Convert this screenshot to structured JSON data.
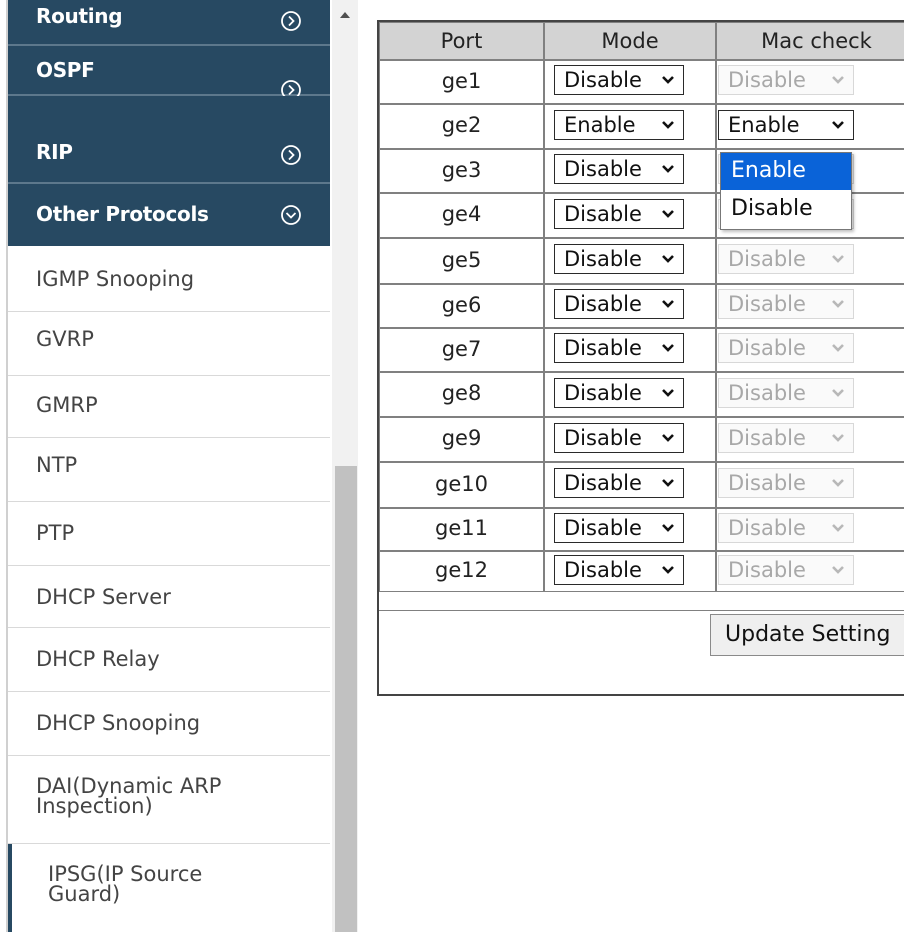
{
  "sidebar": {
    "sections": [
      {
        "label": "Routing",
        "icon": "chevron-right-circle-icon"
      },
      {
        "label": "OSPF",
        "icon": "chevron-right-circle-icon"
      },
      {
        "label": "RIP",
        "icon": "chevron-right-circle-icon"
      },
      {
        "label": "Other Protocols",
        "icon": "chevron-down-circle-icon"
      }
    ],
    "items": [
      {
        "label": "IGMP Snooping"
      },
      {
        "label": "GVRP"
      },
      {
        "label": "GMRP"
      },
      {
        "label": "NTP"
      },
      {
        "label": "PTP"
      },
      {
        "label": "DHCP Server"
      },
      {
        "label": "DHCP Relay"
      },
      {
        "label": "DHCP Snooping"
      },
      {
        "label_line1": "DAI(Dynamic ARP",
        "label_line2": "Inspection)"
      },
      {
        "label_line1": "IPSG(IP Source",
        "label_line2": "Guard)",
        "active": true
      }
    ]
  },
  "table": {
    "headers": {
      "port": "Port",
      "mode": "Mode",
      "mac_check": "Mac check"
    },
    "rows": [
      {
        "port": "ge1",
        "mode": "Disable",
        "mac_check": "Disable"
      },
      {
        "port": "ge2",
        "mode": "Enable",
        "mac_check": "Enable"
      },
      {
        "port": "ge3",
        "mode": "Disable",
        "mac_check": "Disable"
      },
      {
        "port": "ge4",
        "mode": "Disable",
        "mac_check": "Disable"
      },
      {
        "port": "ge5",
        "mode": "Disable",
        "mac_check": "Disable"
      },
      {
        "port": "ge6",
        "mode": "Disable",
        "mac_check": "Disable"
      },
      {
        "port": "ge7",
        "mode": "Disable",
        "mac_check": "Disable"
      },
      {
        "port": "ge8",
        "mode": "Disable",
        "mac_check": "Disable"
      },
      {
        "port": "ge9",
        "mode": "Disable",
        "mac_check": "Disable"
      },
      {
        "port": "ge10",
        "mode": "Disable",
        "mac_check": "Disable"
      },
      {
        "port": "ge11",
        "mode": "Disable",
        "mac_check": "Disable"
      },
      {
        "port": "ge12",
        "mode": "Disable",
        "mac_check": "Disable"
      }
    ],
    "dropdown_options": [
      "Enable",
      "Disable"
    ],
    "dropdown_selected": "Enable",
    "update_button": "Update Setting"
  },
  "colors": {
    "sidebar_section_bg": "#274962",
    "header_bg": "#d3d3d3",
    "dropdown_highlight": "#0a63d8"
  }
}
